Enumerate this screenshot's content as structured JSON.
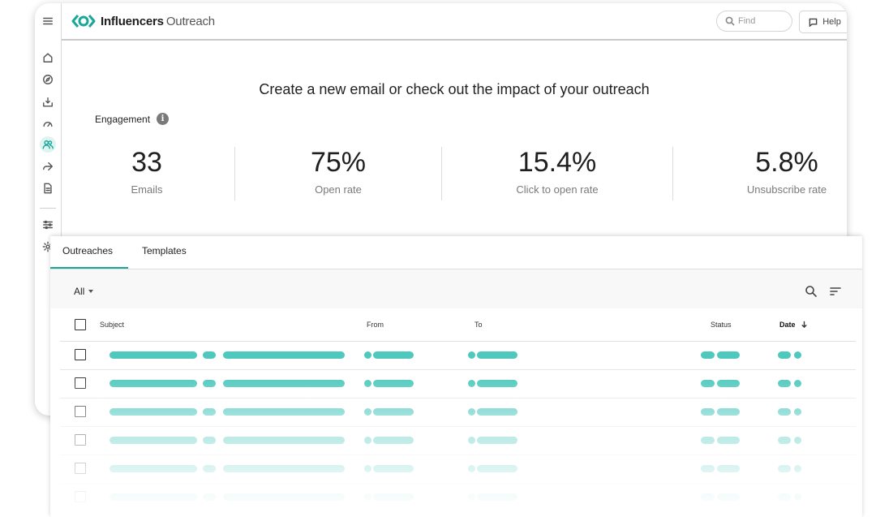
{
  "app": {
    "brand_name": "Influencers",
    "brand_sub": "Outreach",
    "brand_color": "#1aa69a"
  },
  "sidebar": {
    "items": [
      {
        "icon": "menu-icon"
      },
      {
        "icon": "home-icon"
      },
      {
        "icon": "compass-icon"
      },
      {
        "icon": "inbox-download-icon"
      },
      {
        "icon": "gauge-icon"
      },
      {
        "icon": "users-icon",
        "active": true
      },
      {
        "icon": "share-arrow-icon"
      },
      {
        "icon": "document-icon"
      },
      {
        "icon": "sliders-icon"
      },
      {
        "icon": "gear-icon"
      }
    ]
  },
  "header": {
    "search_placeholder": "Find",
    "help_label": "Help"
  },
  "dashboard": {
    "headline": "Create a new email or check out the impact of your outreach",
    "engagement_label": "Engagement",
    "info_glyph": "i",
    "stats": [
      {
        "value": "33",
        "label": "Emails"
      },
      {
        "value": "75%",
        "label": "Open rate"
      },
      {
        "value": "15.4%",
        "label": "Click to open rate"
      },
      {
        "value": "5.8%",
        "label": "Unsubscribe rate"
      }
    ]
  },
  "outreach_panel": {
    "tabs": [
      {
        "label": "Outreaches",
        "active": true
      },
      {
        "label": "Templates",
        "active": false
      }
    ],
    "filter_value": "All",
    "columns": {
      "subject": "Subject",
      "from": "From",
      "to": "To",
      "status": "Status",
      "date": "Date"
    },
    "sort": {
      "column": "Date",
      "direction": "descending"
    },
    "placeholder_color": "#4fc9be",
    "rows_visible": 6
  }
}
